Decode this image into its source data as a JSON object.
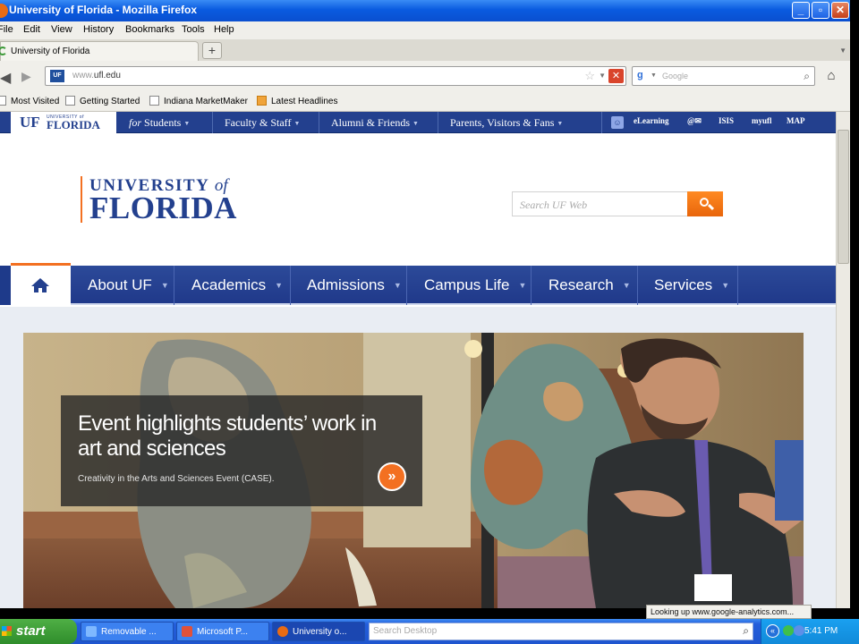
{
  "window": {
    "title": "University of Florida - Mozilla Firefox",
    "min_label": "_",
    "max_label": "▫",
    "close_label": "✕"
  },
  "menu": [
    "File",
    "Edit",
    "View",
    "History",
    "Bookmarks",
    "Tools",
    "Help"
  ],
  "tabs": [
    {
      "label": "University of Florida"
    }
  ],
  "newtab_label": "+",
  "url": {
    "prefix": "www.",
    "host": "ufl.edu",
    "favicon_text": "UF"
  },
  "search_engine_placeholder": "Google",
  "bookmarks": [
    "Most Visited",
    "Getting Started",
    "Indiana MarketMaker",
    "Latest Headlines"
  ],
  "site": {
    "badge": {
      "short": "UF",
      "small": "UNIVERSITY of",
      "big": "FLORIDA"
    },
    "utility_links": [
      {
        "prefix": "for",
        "label": "Students"
      },
      {
        "prefix": "",
        "label": "Faculty & Staff"
      },
      {
        "prefix": "",
        "label": "Alumni & Friends"
      },
      {
        "prefix": "",
        "label": "Parents, Visitors & Fans"
      }
    ],
    "utility_tools": [
      "eLearning",
      "@",
      "ISIS",
      "myufl",
      "MAP"
    ],
    "logo": {
      "line1": "UNIVERSITY",
      "line1_of": "of",
      "line2": "FLORIDA"
    },
    "search_placeholder": "Search UF Web",
    "nav": [
      "About UF",
      "Academics",
      "Admissions",
      "Campus Life",
      "Research",
      "Services"
    ],
    "hero": {
      "headline": "Event highlights students’ work in art and sciences",
      "subtitle": "Creativity in the Arts and Sciences Event (CASE).",
      "more": "»"
    }
  },
  "status_text": "Looking up www.google-analytics.com...",
  "taskbar": {
    "start": "start",
    "tasks": [
      {
        "label": "Removable ...",
        "color": "#7fb8ff"
      },
      {
        "label": "Microsoft P...",
        "color": "#e0513a"
      },
      {
        "label": "University o...",
        "color": "#e86b15"
      }
    ],
    "search_placeholder": "Search Desktop",
    "clock": "5:41 PM"
  },
  "colors": {
    "brand_blue": "#23408e",
    "brand_orange": "#f37021"
  }
}
